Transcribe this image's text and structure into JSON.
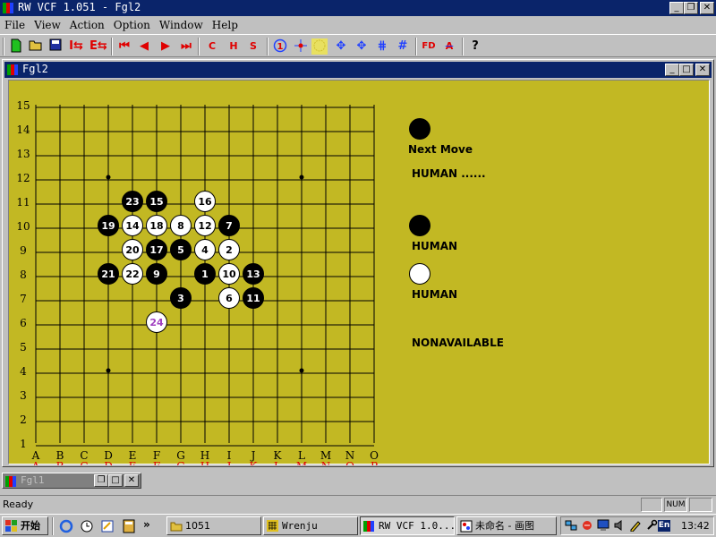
{
  "window": {
    "title": "RW VCF 1.051 - Fgl2"
  },
  "menu": [
    "File",
    "View",
    "Action",
    "Option",
    "Window",
    "Help"
  ],
  "toolbar_icons": [
    "new-file-icon",
    "open-folder-icon",
    "save-icon",
    "import-icon",
    "export-icon",
    "first-move-icon",
    "previous-move-icon",
    "next-move-icon",
    "last-move-icon",
    "c-button",
    "h-button",
    "s-button",
    "numbering-icon",
    "crosshair-icon",
    "highlight-icon",
    "rotate-left-icon",
    "rotate-right-icon",
    "grid-vertical-icon",
    "grid-icon",
    "fd-icon",
    "a-minus-icon",
    "help-icon"
  ],
  "toolbar_letters": {
    "c": "C",
    "h": "H",
    "s": "S",
    "fd": "FD",
    "a": "A",
    "help": "?"
  },
  "child": {
    "title": "Fgl2"
  },
  "minimized": {
    "title": "Fgl1"
  },
  "board": {
    "size": 15,
    "star_points": [
      [
        "D",
        12
      ],
      [
        "L",
        12
      ],
      [
        "D",
        4
      ],
      [
        "L",
        4
      ]
    ],
    "col_labels_black": [
      "A",
      "B",
      "C",
      "D",
      "E",
      "F",
      "G",
      "H",
      "I",
      "J",
      "K",
      "L",
      "M",
      "N",
      "O"
    ],
    "col_labels_red": [
      "A",
      "B",
      "C",
      "D",
      "E",
      "F",
      "G",
      "H",
      "J",
      "K",
      "L",
      "M",
      "N",
      "O",
      "P"
    ],
    "row_labels": [
      "15",
      "14",
      "13",
      "12",
      "11",
      "10",
      "9",
      "8",
      "7",
      "6",
      "5",
      "4",
      "3",
      "2",
      "1"
    ],
    "colors": {
      "board": "#c2b823",
      "red_label": "#e00000"
    },
    "stones": [
      {
        "n": "1",
        "col": "H",
        "row": 8,
        "color": "black"
      },
      {
        "n": "2",
        "col": "I",
        "row": 9,
        "color": "white"
      },
      {
        "n": "3",
        "col": "G",
        "row": 7,
        "color": "black"
      },
      {
        "n": "4",
        "col": "H",
        "row": 9,
        "color": "white"
      },
      {
        "n": "5",
        "col": "G",
        "row": 9,
        "color": "black"
      },
      {
        "n": "6",
        "col": "I",
        "row": 7,
        "color": "white"
      },
      {
        "n": "7",
        "col": "I",
        "row": 10,
        "color": "black"
      },
      {
        "n": "8",
        "col": "G",
        "row": 10,
        "color": "white"
      },
      {
        "n": "9",
        "col": "F",
        "row": 8,
        "color": "black"
      },
      {
        "n": "10",
        "col": "I",
        "row": 8,
        "color": "white"
      },
      {
        "n": "11",
        "col": "J",
        "row": 7,
        "color": "black"
      },
      {
        "n": "12",
        "col": "H",
        "row": 10,
        "color": "white"
      },
      {
        "n": "13",
        "col": "J",
        "row": 8,
        "color": "black"
      },
      {
        "n": "14",
        "col": "E",
        "row": 10,
        "color": "white"
      },
      {
        "n": "15",
        "col": "F",
        "row": 11,
        "color": "black"
      },
      {
        "n": "16",
        "col": "H",
        "row": 11,
        "color": "white"
      },
      {
        "n": "17",
        "col": "F",
        "row": 9,
        "color": "black"
      },
      {
        "n": "18",
        "col": "F",
        "row": 10,
        "color": "white"
      },
      {
        "n": "19",
        "col": "D",
        "row": 10,
        "color": "black"
      },
      {
        "n": "20",
        "col": "E",
        "row": 9,
        "color": "white"
      },
      {
        "n": "21",
        "col": "D",
        "row": 8,
        "color": "black"
      },
      {
        "n": "22",
        "col": "E",
        "row": 8,
        "color": "white"
      },
      {
        "n": "23",
        "col": "E",
        "row": 11,
        "color": "black"
      },
      {
        "n": "24",
        "col": "F",
        "row": 6,
        "color": "white",
        "last": true
      }
    ]
  },
  "panel": {
    "next_move_label": "Next Move",
    "next_move_color": "black",
    "next_player": "HUMAN ......",
    "black_player": "HUMAN",
    "white_player": "HUMAN",
    "status": "NONAVAILABLE"
  },
  "statusbar": {
    "text": "Ready",
    "num": "NUM"
  },
  "taskbar": {
    "start": "开始",
    "buttons": [
      "1051",
      "Wrenju",
      "RW VCF 1.0...",
      "未命名 - 画图"
    ],
    "clock": "13:42",
    "lang": "En"
  }
}
